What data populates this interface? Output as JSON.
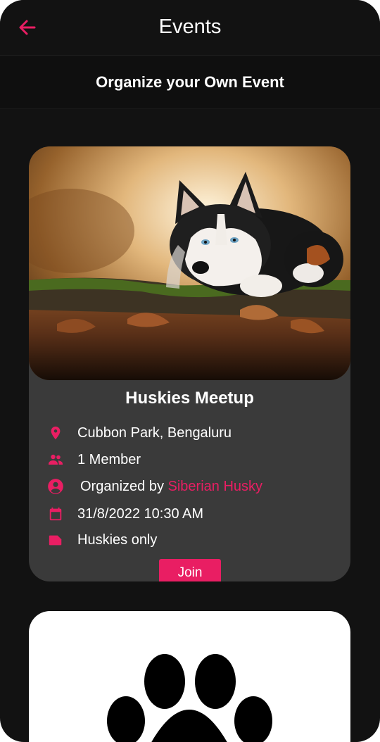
{
  "appbar": {
    "back_icon": "arrow-back-icon",
    "title": "Events"
  },
  "organize": {
    "label": "Organize your Own Event"
  },
  "events": [
    {
      "name": "Huskies Meetup",
      "image_icon": "husky-photo",
      "details": {
        "location": "Cubbon Park, Bengaluru",
        "members": "1 Member",
        "organized_prefix": "Organized by ",
        "organizer": "Siberian Husky",
        "datetime": "31/8/2022 10:30 AM",
        "restriction": "Huskies only"
      },
      "join_label": "Join"
    },
    {
      "image_icon": "paw-print-image"
    }
  ],
  "colors": {
    "accent": "#e91e63",
    "background": "#121212",
    "card": "#3a3a3a"
  }
}
